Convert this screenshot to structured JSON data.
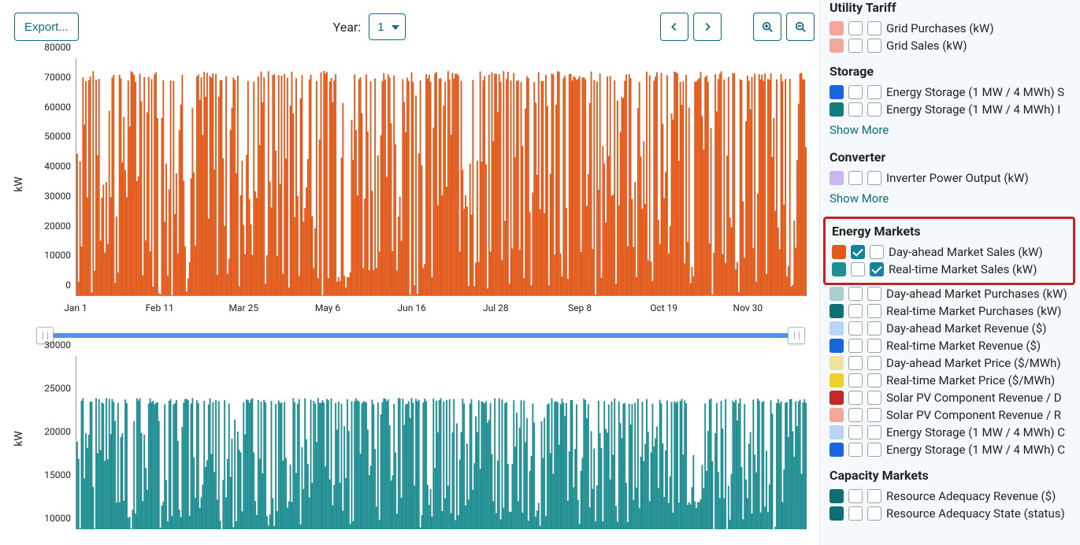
{
  "toolbar": {
    "export_label": "Export...",
    "year_label": "Year:",
    "year_value": "1"
  },
  "chart_data": [
    {
      "type": "bar",
      "series_name": "Day-ahead Market Sales (kW)",
      "color": "#e25a1b",
      "ylabel": "kW",
      "ylim": [
        0,
        80000
      ],
      "y_ticks": [
        0,
        10000,
        20000,
        30000,
        40000,
        50000,
        60000,
        70000,
        80000
      ],
      "x_categories": [
        "Jan 1",
        "Feb 11",
        "Mar 25",
        "May 6",
        "Jun 16",
        "Jul 28",
        "Sep 8",
        "Oct 19",
        "Nov 30"
      ],
      "approx_peak": 75000,
      "note": "dense hourly series across one year; most peaks reach approximately 74000 kW, troughs drop near 0; rightmost bar approximately 50000"
    },
    {
      "type": "bar",
      "series_name": "Real-time Market Sales (kW)",
      "color": "#1f8e92",
      "ylabel": "kW",
      "ylim": [
        10000,
        30000
      ],
      "y_ticks": [
        10000,
        15000,
        20000,
        25000,
        30000
      ],
      "x_categories": [
        "Jan 1",
        "Feb 11",
        "Mar 25",
        "May 6",
        "Jun 16",
        "Jul 28",
        "Sep 8",
        "Oct 19",
        "Nov 30"
      ],
      "approx_peak": 25000,
      "note": "dense hourly series; most peaks approximately 24500 kW, visible floor at 10000"
    }
  ],
  "side": {
    "utility_tariff": {
      "title": "Utility Tariff",
      "items": [
        {
          "color": "#f3a79a",
          "label": "Grid Purchases (kW)",
          "c1": false,
          "c2": false
        },
        {
          "color": "#f3a79a",
          "label": "Grid Sales (kW)",
          "c1": false,
          "c2": false
        }
      ]
    },
    "storage": {
      "title": "Storage",
      "items": [
        {
          "color": "#1766e0",
          "label": "Energy Storage (1 MW / 4 MWh) S",
          "c1": false,
          "c2": false
        },
        {
          "color": "#127d7f",
          "label": "Energy Storage (1 MW / 4 MWh) I",
          "c1": false,
          "c2": false
        }
      ],
      "show_more": "Show More"
    },
    "converter": {
      "title": "Converter",
      "items": [
        {
          "color": "#c9b6f2",
          "label": "Inverter Power Output (kW)",
          "c1": false,
          "c2": false
        }
      ],
      "show_more": "Show More"
    },
    "energy_markets": {
      "title": "Energy Markets",
      "highlighted": [
        {
          "color": "#e25a1b",
          "label": "Day-ahead Market Sales (kW)",
          "c1": true,
          "c2": false
        },
        {
          "color": "#1f8e92",
          "label": "Real-time Market Sales (kW)",
          "c1": false,
          "c2": true
        }
      ],
      "rest": [
        {
          "color": "#a9cfd1",
          "label": "Day-ahead Market Purchases (kW)",
          "c1": false,
          "c2": false
        },
        {
          "color": "#0f6f74",
          "label": "Real-time Market Purchases (kW)",
          "c1": false,
          "c2": false
        },
        {
          "color": "#b9d4f5",
          "label": "Day-ahead Market Revenue ($)",
          "c1": false,
          "c2": false
        },
        {
          "color": "#1766e0",
          "label": "Real-time Market Revenue ($)",
          "c1": false,
          "c2": false
        },
        {
          "color": "#f1e29a",
          "label": "Day-ahead Market Price ($/MWh)",
          "c1": false,
          "c2": false
        },
        {
          "color": "#f0cf2a",
          "label": "Real-time Market Price ($/MWh)",
          "c1": false,
          "c2": false
        },
        {
          "color": "#c62828",
          "label": "Solar PV Component Revenue / D",
          "c1": false,
          "c2": false
        },
        {
          "color": "#f3a79a",
          "label": "Solar PV Component Revenue / R",
          "c1": false,
          "c2": false
        },
        {
          "color": "#b9d4f5",
          "label": "Energy Storage (1 MW / 4 MWh) C",
          "c1": false,
          "c2": false
        },
        {
          "color": "#1766e0",
          "label": "Energy Storage (1 MW / 4 MWh) C",
          "c1": false,
          "c2": false
        }
      ]
    },
    "capacity_markets": {
      "title": "Capacity Markets",
      "items": [
        {
          "color": "#0f6f74",
          "label": "Resource Adequacy Revenue ($)",
          "c1": false,
          "c2": false
        },
        {
          "color": "#0f6f74",
          "label": "Resource Adequacy State (status)",
          "c1": false,
          "c2": false
        }
      ]
    }
  }
}
